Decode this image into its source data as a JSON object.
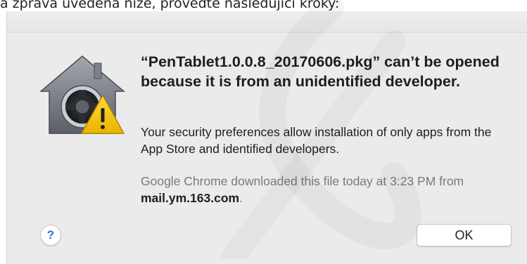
{
  "caption": "a zpráva uvedená níže, proveďte následující kroky:",
  "dialog": {
    "icon": "gatekeeper-security-icon",
    "title": "“PenTablet1.0.0.8_20170606.pkg” can’t be opened because it is from an unidentified developer.",
    "message": "Your security preferences allow installation of only apps from the App Store and identified developers.",
    "info_prefix": "Google Chrome downloaded this file today at 3:23 PM from ",
    "info_domain": "mail.ym.163.com",
    "info_suffix": ".",
    "help_label": "?",
    "ok_label": "OK"
  },
  "colors": {
    "dialog_bg": "#ebebeb",
    "help_accent": "#2d6fd6",
    "warning_yellow": "#f5c400"
  }
}
